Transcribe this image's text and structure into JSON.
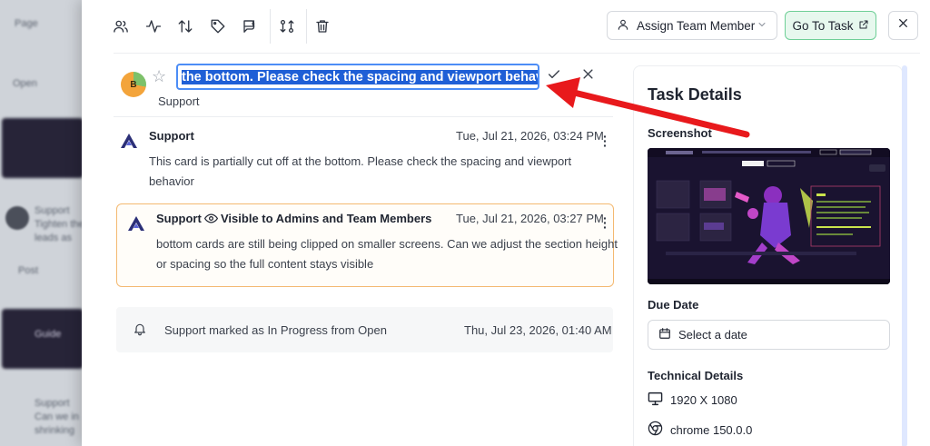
{
  "backdrop": {
    "page_label": "Page",
    "open_label": "Open",
    "item1_author": "Support",
    "item1_line1": "Tighten the",
    "item1_line2": "leads as",
    "item1_meta": "Post",
    "card_label": "Guide",
    "item2_author": "Support",
    "item2_line1": "Can we in",
    "item2_line2": "shrinking"
  },
  "toolbar": {
    "icons": [
      "users-icon",
      "activity-icon",
      "sort-icon",
      "tag-icon",
      "flag-icon",
      "transfer-icon",
      "trash-icon"
    ],
    "assign_label": "Assign Team Member",
    "goto_label": "Go To Task"
  },
  "title_edit": {
    "avatar_initial": "B",
    "value": "the bottom. Please check the spacing and viewport behavior",
    "subtitle": "Support"
  },
  "comments": [
    {
      "author": "Support",
      "visibility": "",
      "time": "Tue, Jul 21, 2026, 03:24 PM",
      "body": "This card is partially cut off at the bottom. Please check the spacing and viewport behavior"
    },
    {
      "author": "Support",
      "visibility": "Visible to Admins and Team Members",
      "time": "Tue, Jul 21, 2026, 03:27 PM",
      "body_line1": "bottom cards are still being clipped on smaller screens. Can we adjust the section height",
      "body_line2": "or spacing so the full content stays visible"
    }
  ],
  "activity": {
    "text": "Support marked as In Progress from Open",
    "time": "Thu, Jul 23, 2026, 01:40 AM"
  },
  "task_details": {
    "title": "Task Details",
    "screenshot_label": "Screenshot",
    "due_date_label": "Due Date",
    "due_date_placeholder": "Select a date",
    "technical_label": "Technical Details",
    "resolution": "1920 X 1080",
    "browser": "chrome 150.0.0"
  },
  "colors": {
    "accent_blue": "#4c8df6",
    "goto_green_bg": "#e7f8ee",
    "goto_green_border": "#6fcf97",
    "internal_comment_border": "#f4b971",
    "annotation_red": "#e8191c"
  }
}
